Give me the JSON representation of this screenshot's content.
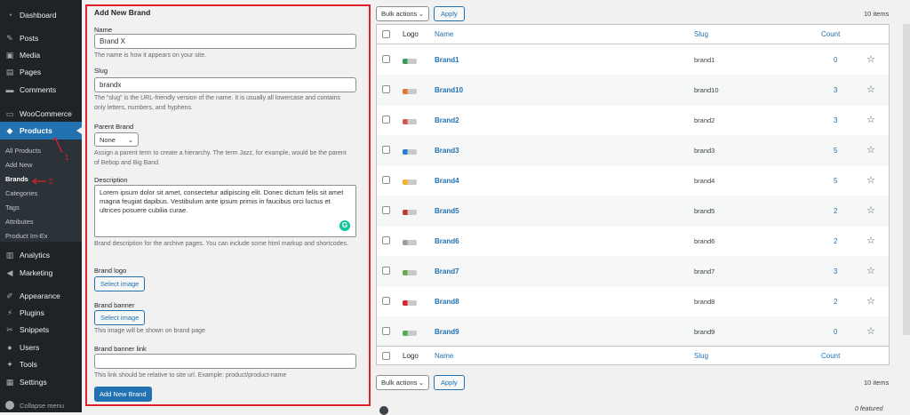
{
  "sidebar": {
    "menu_top": [
      {
        "label": "Dashboard",
        "icon": "dashboard-icon"
      },
      {
        "label": "Posts",
        "icon": "pin-icon"
      },
      {
        "label": "Media",
        "icon": "media-icon"
      },
      {
        "label": "Pages",
        "icon": "page-icon"
      },
      {
        "label": "Comments",
        "icon": "comment-icon"
      },
      {
        "label": "WooCommerce",
        "icon": "woocommerce-icon"
      },
      {
        "label": "Products",
        "icon": "products-icon"
      }
    ],
    "submenu": [
      "All Products",
      "Add New",
      "Brands",
      "Categories",
      "Tags",
      "Attributes",
      "Product Im-Ex"
    ],
    "menu_bottom": [
      {
        "label": "Analytics",
        "icon": "analytics-icon"
      },
      {
        "label": "Marketing",
        "icon": "marketing-icon"
      },
      {
        "label": "Appearance",
        "icon": "appearance-icon"
      },
      {
        "label": "Plugins",
        "icon": "plugin-icon"
      },
      {
        "label": "Snippets",
        "icon": "snippets-icon"
      },
      {
        "label": "Users",
        "icon": "users-icon"
      },
      {
        "label": "Tools",
        "icon": "tools-icon"
      },
      {
        "label": "Settings",
        "icon": "settings-icon"
      }
    ],
    "collapse_label": "Collapse menu"
  },
  "form": {
    "title": "Add New Brand",
    "name_label": "Name",
    "name_value": "Brand X",
    "name_hint": "The name is how it appears on your site.",
    "slug_label": "Slug",
    "slug_value": "brandx",
    "slug_hint": "The “slug” is the URL-friendly version of the name. It is usually all lowercase and contains only letters, numbers, and hyphens.",
    "parent_label": "Parent Brand",
    "parent_value": "None",
    "parent_hint": "Assign a parent term to create a hierarchy. The term Jazz, for example, would be the parent of Bebop and Big Band.",
    "description_label": "Description",
    "description_value": "Lorem ipsum dolor sit amet, consectetur adipiscing elit. Donec dictum felis sit amet magna feugiat dapibus. Vestibulum ante ipsum primis in faucibus orci luctus et ultrices posuere cubilia curae.",
    "description_hint": "Brand description for the archive pages. You can include some html markup and shortcodes.",
    "logo_label": "Brand logo",
    "logo_button": "Select image",
    "banner_label": "Brand banner",
    "banner_button": "Select image",
    "banner_hint": "This image will be shown on brand page",
    "banner_link_label": "Brand banner link",
    "banner_link_value": "",
    "banner_link_hint": "This link should be relative to site url. Example: product/product-name",
    "submit_label": "Add New Brand"
  },
  "annotations": {
    "one": "1",
    "two": "2",
    "three": "3"
  },
  "toolbar": {
    "bulk_label": "Bulk actions",
    "apply_label": "Apply",
    "items_count": "10 items"
  },
  "table": {
    "headers": {
      "logo": "Logo",
      "name": "Name",
      "slug": "Slug",
      "count": "Count"
    },
    "rows": [
      {
        "name": "Brand1",
        "slug": "brand1",
        "count": "0",
        "logo_color": "#3a9a5b"
      },
      {
        "name": "Brand10",
        "slug": "brand10",
        "count": "3",
        "logo_color": "#e8742a"
      },
      {
        "name": "Brand2",
        "slug": "brand2",
        "count": "3",
        "logo_color": "#d9534f"
      },
      {
        "name": "Brand3",
        "slug": "brand3",
        "count": "5",
        "logo_color": "#2a7fd4"
      },
      {
        "name": "Brand4",
        "slug": "brand4",
        "count": "5",
        "logo_color": "#f0b323"
      },
      {
        "name": "Brand5",
        "slug": "brand5",
        "count": "2",
        "logo_color": "#c0392b"
      },
      {
        "name": "Brand6",
        "slug": "brand6",
        "count": "2",
        "logo_color": "#9b9b9b"
      },
      {
        "name": "Brand7",
        "slug": "brand7",
        "count": "3",
        "logo_color": "#6aa84f"
      },
      {
        "name": "Brand8",
        "slug": "brand8",
        "count": "2",
        "logo_color": "#e0202a"
      },
      {
        "name": "Brand9",
        "slug": "brand9",
        "count": "0",
        "logo_color": "#4caf50"
      }
    ]
  },
  "footer": {
    "featured_text": "0 featured"
  },
  "colors": {
    "accent": "#2271b1",
    "annotation": "#e0202a",
    "sidebar": "#1d2327"
  }
}
